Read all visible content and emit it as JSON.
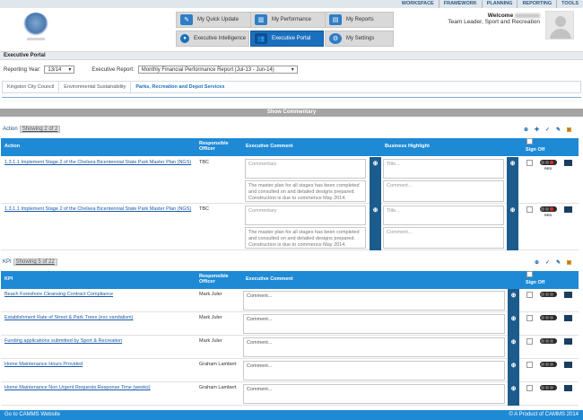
{
  "topnav": [
    "WORKSPACE",
    "FRAMEWORK",
    "PLANNING",
    "REPORTING",
    "TOOLS"
  ],
  "tiles": [
    {
      "label": "My Quick Update",
      "icon": "pencil-icon",
      "active": false
    },
    {
      "label": "My Performance",
      "icon": "chart-icon",
      "active": false
    },
    {
      "label": "My Reports",
      "icon": "report-icon",
      "active": false
    },
    {
      "label": "Executive Intelligence",
      "icon": "bulb-icon",
      "active": false
    },
    {
      "label": "Executive Portal",
      "icon": "people-icon",
      "active": true
    },
    {
      "label": "My Settings",
      "icon": "gear-icon",
      "active": false
    }
  ],
  "user": {
    "welcome": "Welcome",
    "role": "Team Leader, Sport and Recreation"
  },
  "portal_title": "Executive Portal",
  "filters": {
    "year_label": "Reporting Year:",
    "year_value": "13/14",
    "report_label": "Executive Report:",
    "report_value": "Monthly Financial Performance Report (Jul-13 - Jun-14)"
  },
  "breadcrumbs": [
    "Kingston City Council",
    "Environmental Sustainability",
    "Parks, Recreation and Depot Services"
  ],
  "commentary_toggle": "Show Commentary",
  "action": {
    "label": "Action",
    "showing": "Showing 2 of 2",
    "headers": {
      "col1": "Action",
      "col2": "Responsible Officer",
      "col3": "Executive Comment",
      "col4": "Business Highlight",
      "col5": "Sign Off"
    },
    "rows": [
      {
        "name": "1.3.1.1 Implement Stage 2 of the Chelsea Bicentennial State Park Master Plan (NGS)",
        "officer": "TBC",
        "comment_ph": "Commentary",
        "status_text": "The master plan for all stages has been completed and consulted on and detailed designs prepared. Construction is due to commence May 2014.",
        "title_ph": "Title...",
        "bcomment_ph": "Comment...",
        "rating": "RED"
      },
      {
        "name": "1.3.1.1 Implement Stage 2 of the Chelsea Bicentennial State Park Master Plan (NGS)",
        "officer": "TBC",
        "comment_ph": "Commentary",
        "status_text": "The master plan for all stages has been completed and consulted on and detailed designs prepared. Construction is due to commence May 2014.",
        "title_ph": "Title...",
        "bcomment_ph": "Comment...",
        "rating": "RED"
      }
    ]
  },
  "kpi": {
    "label": "KPI",
    "showing": "Showing 5 of 22",
    "headers": {
      "col1": "KPI",
      "col2": "Responsible Officer",
      "col3": "Executive Comment",
      "col5": "Sign Off"
    },
    "rows": [
      {
        "name": "Beach Foreshore Cleansing Contract Compliance",
        "officer": "Mark Juler",
        "comment_ph": "Comment..."
      },
      {
        "name": "Establishment Rate of Street & Park Trees (exc vandalism)",
        "officer": "Mark Juler",
        "comment_ph": "Comment..."
      },
      {
        "name": "Funding applications submitted by Sport & Recreation",
        "officer": "Mark Juler",
        "comment_ph": "Comment..."
      },
      {
        "name": "Home Maintenance Hours Provided",
        "officer": "Graham Lambert",
        "comment_ph": "Comment..."
      },
      {
        "name": "Home Maintenance Non Urgent Requests Response Time (weeks)",
        "officer": "Graham Lambert",
        "comment_ph": "Comment..."
      }
    ]
  },
  "footer": {
    "left": "Go to CAMMS Website",
    "right": "© A Product of CAMMS 2014"
  },
  "colors": {
    "accent": "#1e8ad6",
    "active_tile": "#1b6fbd",
    "rating_red": "#e12a2a"
  }
}
